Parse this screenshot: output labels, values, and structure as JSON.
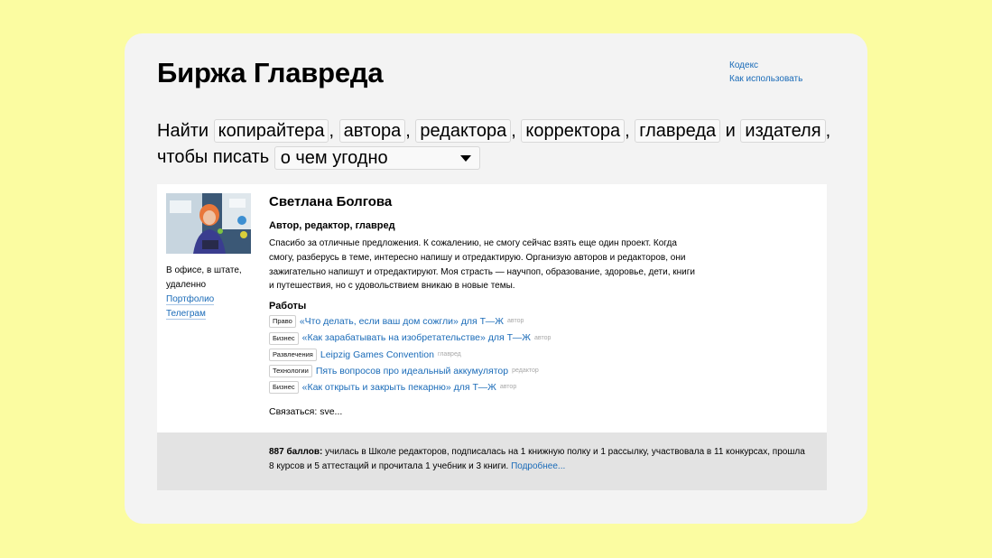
{
  "site": {
    "title": "Биржа Главреда",
    "links": [
      "Кодекс",
      "Как использовать"
    ]
  },
  "search": {
    "prefix": "Найти",
    "roles": [
      "копирайтера",
      "автора",
      "редактора",
      "корректора",
      "главреда",
      "издателя"
    ],
    "and_word": "и",
    "line2_prefix": "чтобы писать",
    "topic_selected": "о чем угодно"
  },
  "profile": {
    "name": "Светлана Болгова",
    "role": "Автор, редактор, главред",
    "bio": "Спасибо за отличные предложения. К сожалению, не смогу сейчас взять еще один проект. Когда смогу, разберусь в теме, интересно напишу и отредактирую. Организую авторов и редакторов, они зажигательно напишут и отредактируют. Моя страсть — научпоп, образование, здоровье, дети, книги и путешествия, но с удовольствием вникаю в новые темы.",
    "work_format": "В офисе, в штате, удаленно",
    "portfolio_label": "Портфолио",
    "telegram_label": "Телеграм",
    "works_title": "Работы",
    "works": [
      {
        "tag": "Право",
        "title": "«Что делать, если ваш дом сожгли» для Т—Ж",
        "role": "автор"
      },
      {
        "tag": "Бизнес",
        "title": "«Как зарабатывать на изобретательстве» для Т—Ж",
        "role": "автор"
      },
      {
        "tag": "Развлечения",
        "title": "Leipzig Games Convention",
        "role": "главред"
      },
      {
        "tag": "Технологии",
        "title": "Пять вопросов про идеальный аккумулятор",
        "role": "редактор"
      },
      {
        "tag": "Бизнес",
        "title": "«Как открыть и закрыть пекарню» для Т—Ж",
        "role": "автор"
      }
    ],
    "contact": "Связаться: sve..."
  },
  "score": {
    "points": "887 баллов:",
    "text": " училась в Школе редакторов, подписалась на 1 книжную полку и 1 рассылку, участвовала в 11 конкурсах, прошла 8 курсов и 5 аттестаций и прочитала 1 учебник и 3 книги. ",
    "more_label": "Подробнее..."
  },
  "colors": {
    "page_bg": "#fbfca1",
    "window_bg": "#f3f3f3",
    "link": "#1a6bb8",
    "score_bg": "#e3e3e3"
  }
}
